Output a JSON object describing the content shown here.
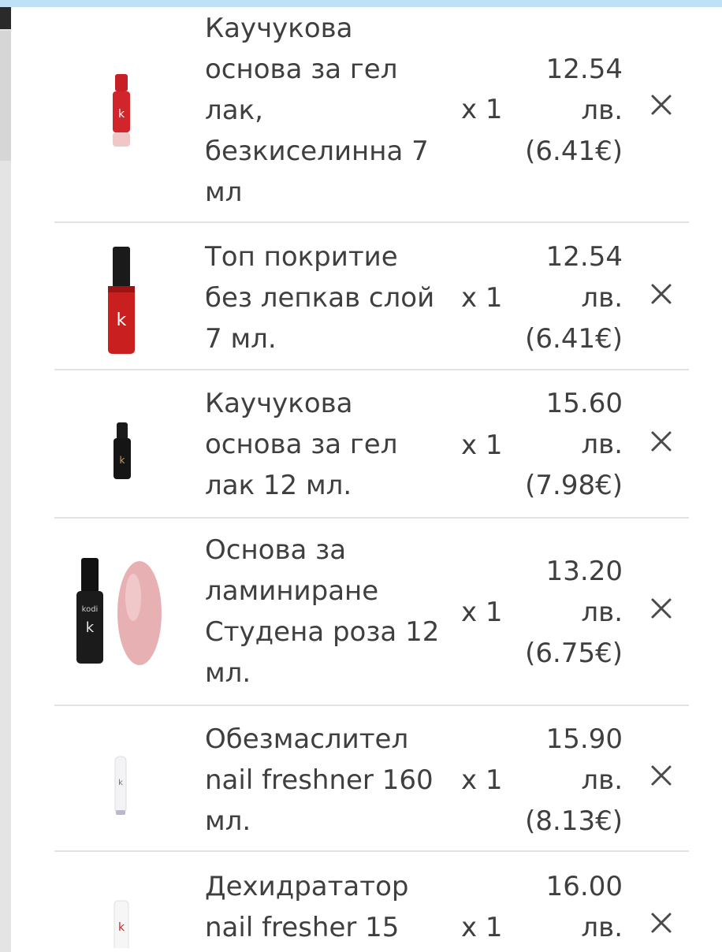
{
  "cart": {
    "items": [
      {
        "name": "Каучукова основа за гел лак, безкиселинна 7 мл",
        "qty": "x 1",
        "price_bgn": "12.54",
        "currency": "лв.",
        "price_eur": "(6.41€)",
        "image_icon": "red-nail-polish-bottle-icon"
      },
      {
        "name": "Топ покритие без лепкав слой 7 мл.",
        "qty": "x 1",
        "price_bgn": "12.54",
        "currency": "лв.",
        "price_eur": "(6.41€)",
        "image_icon": "red-top-coat-bottle-icon"
      },
      {
        "name": "Каучукова основа за гел лак 12 мл.",
        "qty": "x 1",
        "price_bgn": "15.60",
        "currency": "лв.",
        "price_eur": "(7.98€)",
        "image_icon": "black-base-bottle-icon"
      },
      {
        "name": "Основа за ламиниране Студена роза 12 мл.",
        "qty": "x 1",
        "price_bgn": "13.20",
        "currency": "лв.",
        "price_eur": "(6.75€)",
        "image_icon": "black-bottle-with-pink-swatch-icon"
      },
      {
        "name": "Обезмаслител nail freshner 160 мл.",
        "qty": "x 1",
        "price_bgn": "15.90",
        "currency": "лв.",
        "price_eur": "(8.13€)",
        "image_icon": "white-spray-bottle-icon"
      },
      {
        "name": "Дехидрататор nail fresher 15",
        "qty": "x 1",
        "price_bgn": "16.00",
        "currency": "лв.",
        "price_eur": "",
        "image_icon": "white-small-bottle-icon"
      }
    ]
  },
  "colors": {
    "text": "#3f3f3f",
    "divider": "#e2e2e2",
    "topbar": "#bfe1f6",
    "polish_red": "#d0262b",
    "pink_swatch": "#e7b1b4"
  },
  "icons": {
    "remove": "close-icon"
  }
}
